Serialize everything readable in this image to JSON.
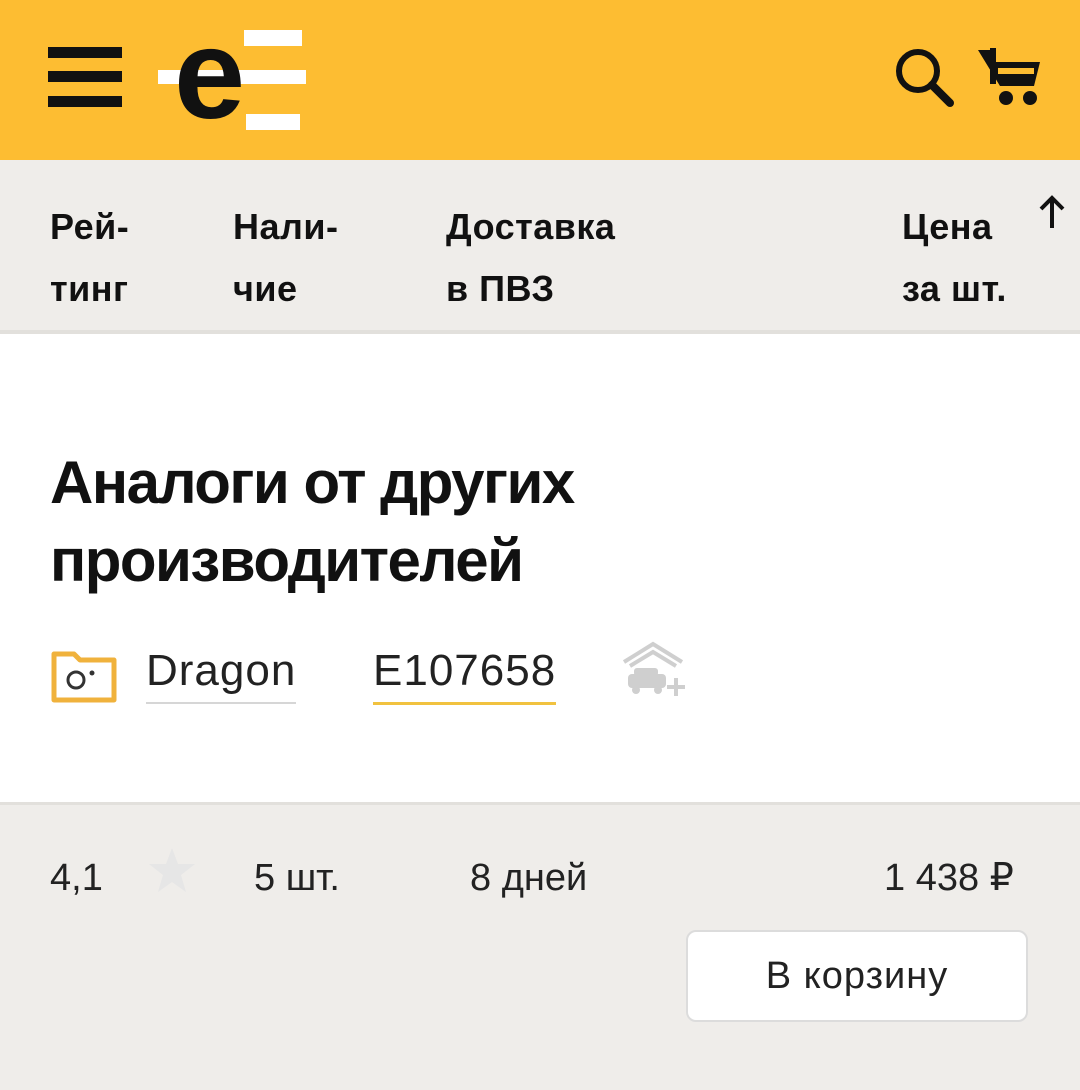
{
  "header": {
    "menu_icon": "hamburger-menu-icon",
    "logo_letter": "e",
    "search_icon": "search-icon",
    "cart_icon": "cart-icon",
    "accent_color": "#fdbd32"
  },
  "sort_columns": [
    {
      "label": "Рей-\nтинг"
    },
    {
      "label": "Нали-\nчие"
    },
    {
      "label": "Доставка\nв ПВЗ"
    },
    {
      "label": "Цена\nза шт.",
      "sort_direction": "ascending",
      "icon": "arrow-up-icon"
    }
  ],
  "section": {
    "title": "Аналоги от других производителей",
    "folder_icon": "folder-camera-icon",
    "brand": "Dragon",
    "part_number": "E107658",
    "garage_icon": "add-to-garage-icon"
  },
  "offer": {
    "rating": "4,1",
    "rating_icon": "star-icon",
    "stock": "5 шт.",
    "delivery": "8 дней",
    "price": "1 438 ₽",
    "add_to_cart_label": "В корзину"
  }
}
